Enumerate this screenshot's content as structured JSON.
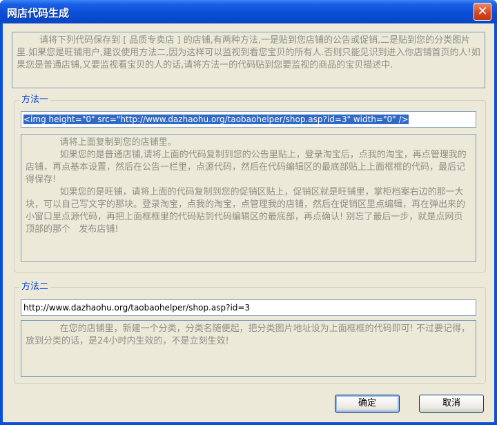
{
  "window": {
    "title": "网店代码生成",
    "close_glyph": "✕"
  },
  "intro": {
    "text": "        请将下列代码保存到 [ 品质专卖店 ] 的店铺,有两种方法,一是贴到您店铺的公告或促销,二是贴到您的分类图片里.如果您是旺铺用户,建议使用方法二,因为这样可以监视到看您宝贝的所有人.否则只能见识到进入你店铺首页的人!如果您是普通店铺,又要监视看宝贝的人的话,请将方法一的代码贴到您要监视的商品的宝贝描述中."
  },
  "method1": {
    "legend": "方法一",
    "code": "<img height=\"0\" src=\"http://www.dazhaohu.org/taobaohelper/shop.asp?id=3\" width=\"0\" />",
    "instructions": "            请将上面复制到您的店铺里。\n            如果您的是普通店铺,请将上面的代码复制到您的公告里贴上，登录淘宝后，点我的淘宝，再点管理我的店铺，再点基本设置，然后在公告一栏里，点源代码，然后在代码编辑区的最底部贴上上面框框的代码，最后记得保存!\n            如果您的是旺铺，请将上面的代码复制到您的促销区贴上，促销区就是旺铺里，掌柜档案右边的那一大块，可以自己写文字的那块。登录淘宝，点我的淘宝，点管理我的店铺，然后在促销区里点编辑，再在弹出来的小窗口里点源代码，再把上面框框里的代码贴到代码编辑区的最底部，再点确认! 别忘了最后一步，就是点网页顶部的那个   发布店铺!"
  },
  "method2": {
    "legend": "方法二",
    "url": "http://www.dazhaohu.org/taobaohelper/shop.asp?id=3",
    "instructions": "            在您的店铺里，新建一个分类，分类名随便起，把分类图片地址设为上面框框的代码即可! 不过要记得，放到分类的话，是24小时内生效的，不是立刻生效!"
  },
  "buttons": {
    "ok": "确定",
    "cancel": "取消"
  }
}
